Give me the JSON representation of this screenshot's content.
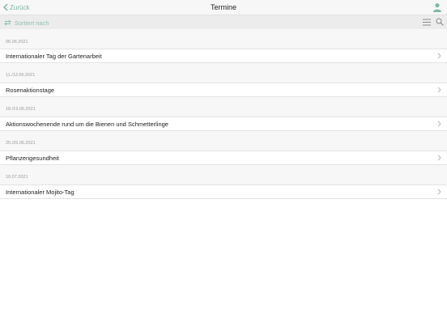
{
  "nav": {
    "back_label": "Zurück",
    "title": "Termine",
    "back_icon": "chevron-left-icon",
    "user_icon": "user-icon"
  },
  "toolbar": {
    "sort_label": "Sortiert nach",
    "sort_icon": "sort-arrows-icon",
    "menu_icon": "menu-icon",
    "search_icon": "search-icon"
  },
  "accent_color": "#7fb8a4",
  "events": [
    {
      "date": "06.06.2021",
      "title": "Internationaler Tag der Gartenarbeit"
    },
    {
      "date": "11./12.06.2021",
      "title": "Rosenaktionstage"
    },
    {
      "date": "18./19.06.2021",
      "title": "Aktionswochenende rund um die Bienen und Schmetterlinge"
    },
    {
      "date": "25./26.06.2021",
      "title": "Pflanzengesundheit"
    },
    {
      "date": "10.07.2021",
      "title": "Internationaler Mojito-Tag"
    }
  ]
}
